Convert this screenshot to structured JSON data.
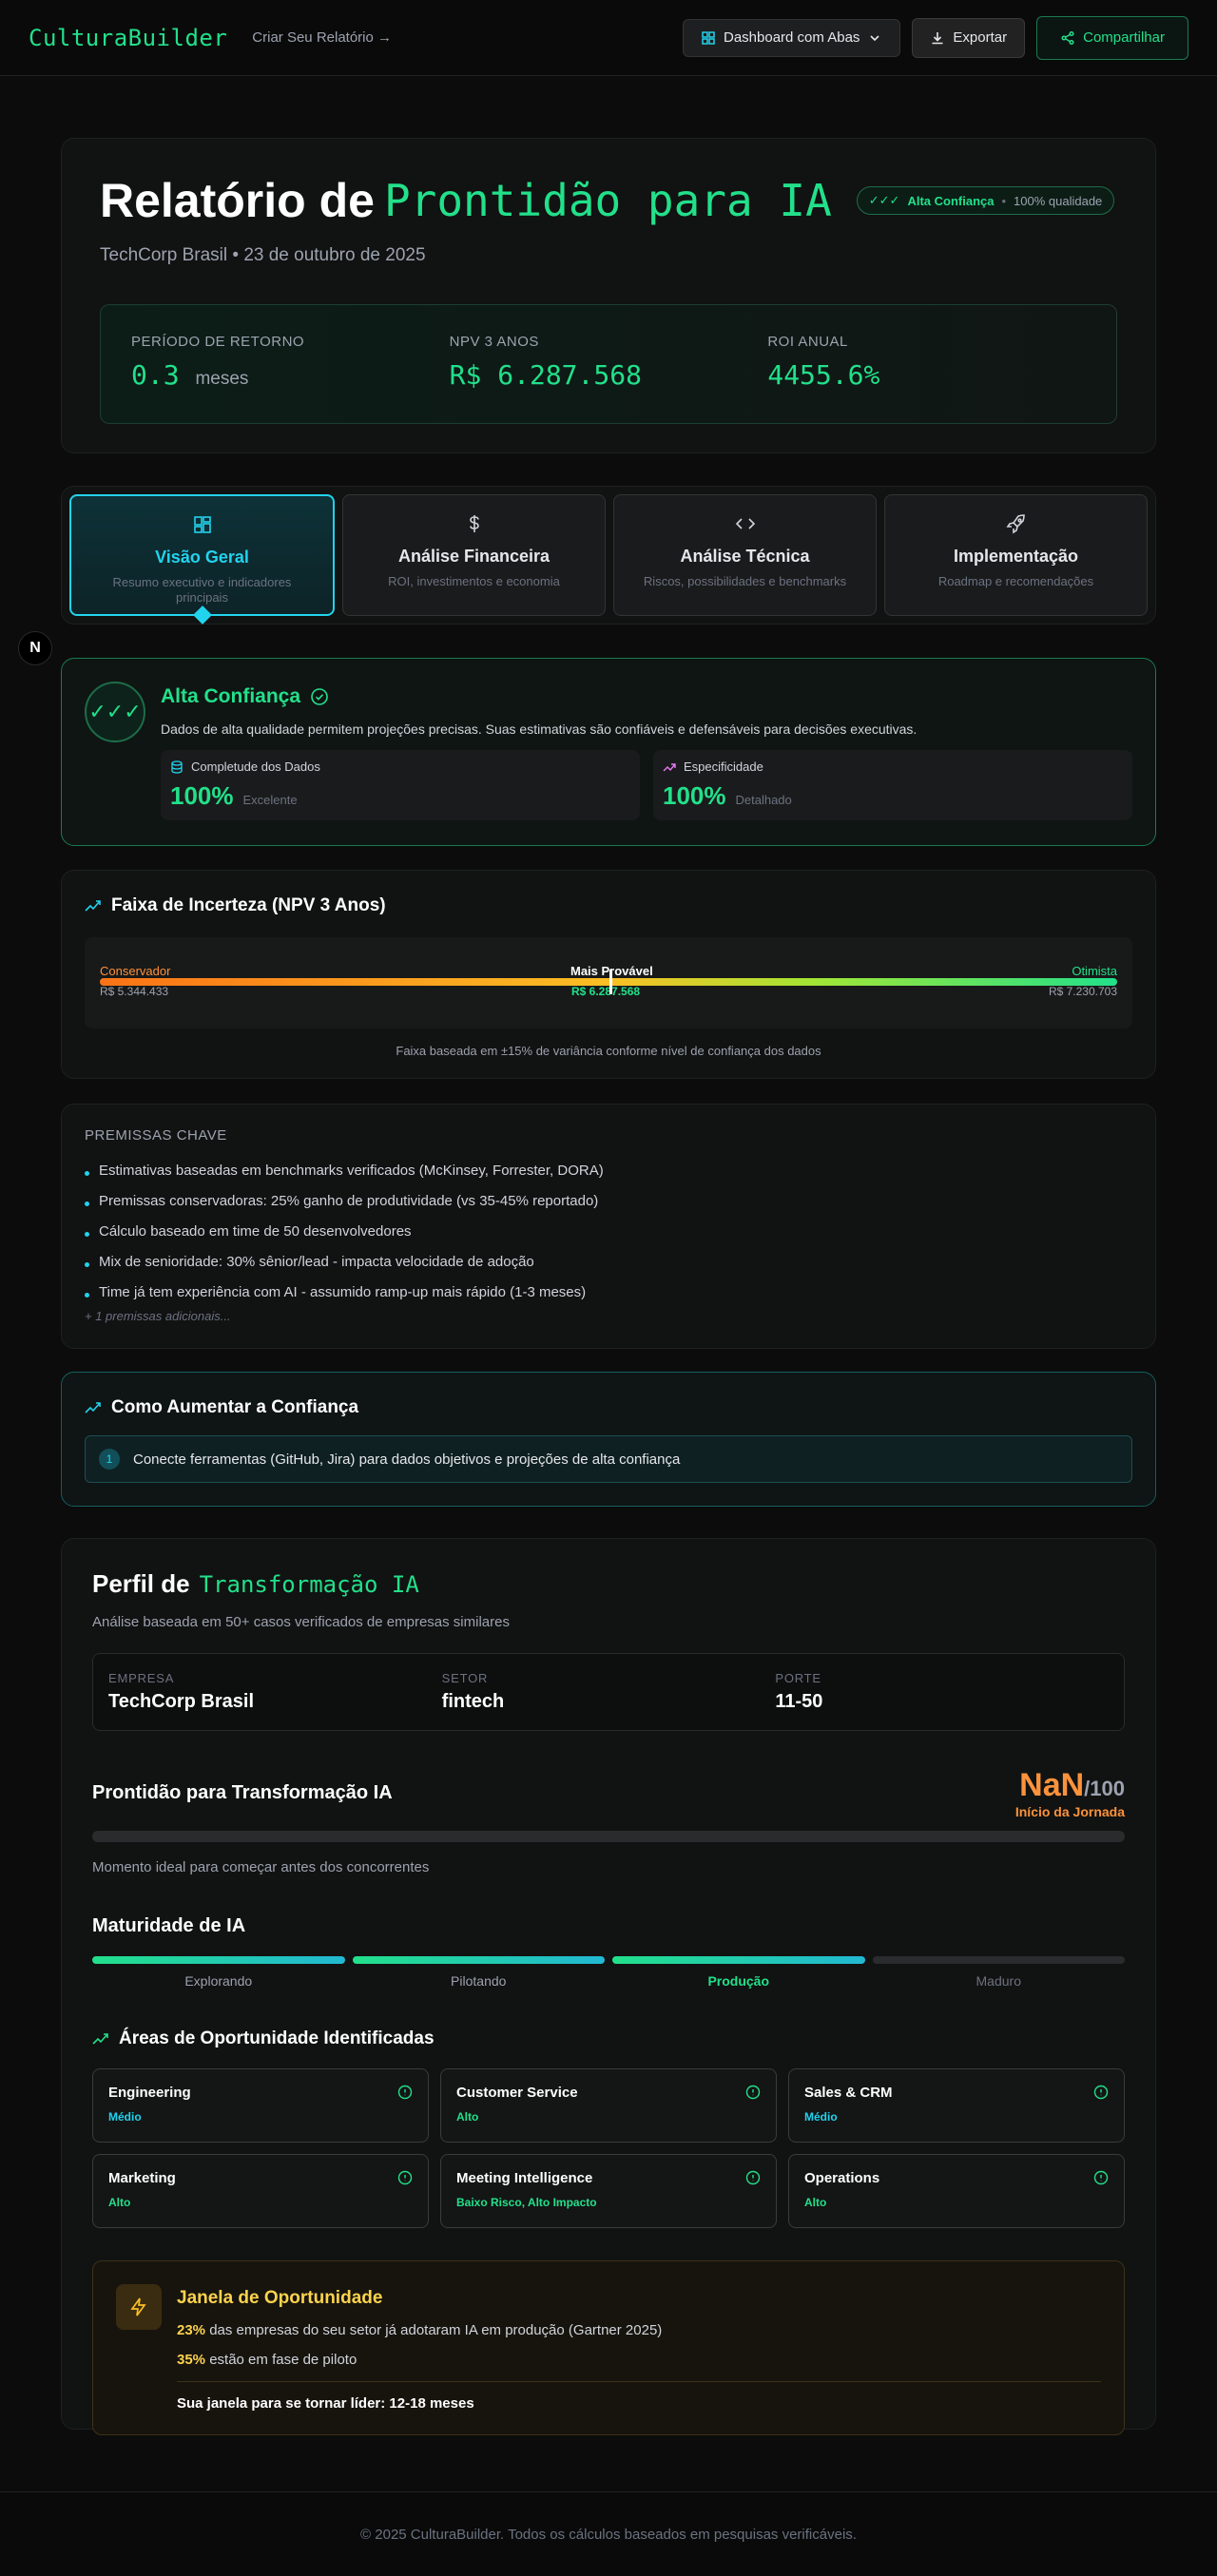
{
  "header": {
    "brand": "CulturaBuilder",
    "create_link": "Criar Seu Relatório →",
    "view_selector": "Dashboard com Abas",
    "export_label": "Exportar",
    "share_label": "Compartilhar"
  },
  "hero": {
    "title_prefix": "Relatório de",
    "title_accent": "Prontidão para IA",
    "badge_checks": "✓✓✓",
    "badge_label": "Alta Confiança",
    "badge_sep": "•",
    "badge_quality": "100% qualidade",
    "subtitle": "TechCorp Brasil • 23 de outubro de 2025",
    "metrics": [
      {
        "label": "PERÍODO DE RETORNO",
        "value": "0.3",
        "unit": "meses"
      },
      {
        "label": "NPV 3 ANOS",
        "value": "R$ 6.287.568",
        "unit": ""
      },
      {
        "label": "ROI ANUAL",
        "value": "4455.6%",
        "unit": ""
      }
    ]
  },
  "tabs": [
    {
      "title": "Visão Geral",
      "desc": "Resumo executivo e indicadores principais",
      "icon": "dashboard-icon",
      "active": true
    },
    {
      "title": "Análise Financeira",
      "desc": "ROI, investimentos e economia",
      "icon": "dollar-icon",
      "active": false
    },
    {
      "title": "Análise Técnica",
      "desc": "Riscos, possibilidades e benchmarks",
      "icon": "code-icon",
      "active": false
    },
    {
      "title": "Implementação",
      "desc": "Roadmap e recomendações",
      "icon": "rocket-icon",
      "active": false
    }
  ],
  "side_button": "N",
  "confidence": {
    "checks": "✓✓✓",
    "title": "Alta Confiança",
    "desc": "Dados de alta qualidade permitem projeções precisas. Suas estimativas são confiáveis e defensáveis para decisões executivas.",
    "stats": [
      {
        "label": "Completude dos Dados",
        "value": "100%",
        "sub": "Excelente"
      },
      {
        "label": "Especificidade",
        "value": "100%",
        "sub": "Detalhado"
      }
    ]
  },
  "range": {
    "title": "Faixa de Incerteza (NPV 3 Anos)",
    "conservative_label": "Conservador",
    "conservative_value": "R$ 5.344.433",
    "likely_label": "Mais Provável",
    "likely_value": "R$ 6.287.568",
    "optimistic_label": "Otimista",
    "optimistic_value": "R$ 7.230.703",
    "footnote": "Faixa baseada em ±15% de variância conforme nível de confiança dos dados"
  },
  "premises": {
    "title": "PREMISSAS CHAVE",
    "items": [
      "Estimativas baseadas em benchmarks verificados (McKinsey, Forrester, DORA)",
      "Premissas conservadoras: 25% ganho de produtividade (vs 35-45% reportado)",
      "Cálculo baseado em time de 50 desenvolvedores",
      "Mix de senioridade: 30% sênior/lead - impacta velocidade de adoção",
      "Time já tem experiência com AI - assumido ramp-up mais rápido (1-3 meses)"
    ],
    "more": "+ 1 premissas adicionais..."
  },
  "improve": {
    "title": "Como Aumentar a Confiança",
    "items": [
      {
        "num": "1",
        "text": "Conecte ferramentas (GitHub, Jira) para dados objetivos e projeções de alta confiança"
      }
    ]
  },
  "profile": {
    "title_prefix": "Perfil de",
    "title_accent": "Transformação IA",
    "subtitle": "Análise baseada em 50+ casos verificados de empresas similares",
    "company": [
      {
        "key": "EMPRESA",
        "value": "TechCorp Brasil"
      },
      {
        "key": "SETOR",
        "value": "fintech"
      },
      {
        "key": "PORTE",
        "value": "11-50"
      }
    ],
    "readiness_title": "Prontidão para Transformação IA",
    "score": "NaN",
    "score_den": "/100",
    "score_label": "Início da Jornada",
    "readiness_note": "Momento ideal para começar antes dos concorrentes",
    "maturity_title": "Maturidade de IA",
    "maturity": [
      {
        "label": "Explorando",
        "state": "done"
      },
      {
        "label": "Pilotando",
        "state": "done"
      },
      {
        "label": "Produção",
        "state": "current"
      },
      {
        "label": "Maduro",
        "state": "off"
      }
    ],
    "areas_title": "Áreas de Oportunidade Identificadas",
    "areas": [
      {
        "name": "Engineering",
        "level": "Médio",
        "color": "#22d3ee"
      },
      {
        "name": "Customer Service",
        "level": "Alto",
        "color": "#22e08a"
      },
      {
        "name": "Sales & CRM",
        "level": "Médio",
        "color": "#22d3ee"
      },
      {
        "name": "Marketing",
        "level": "Alto",
        "color": "#22e08a"
      },
      {
        "name": "Meeting Intelligence",
        "level": "Baixo Risco, Alto Impacto",
        "color": "#22e08a"
      },
      {
        "name": "Operations",
        "level": "Alto",
        "color": "#22e08a"
      }
    ],
    "window": {
      "title": "Janela de Oportunidade",
      "line1_strong": "23%",
      "line1_rest": " das empresas do seu setor já adotaram IA em produção (Gartner 2025)",
      "line2_strong": "35%",
      "line2_rest": " estão em fase de piloto",
      "final": "Sua janela para se tornar líder: 12-18 meses"
    }
  },
  "footer": "© 2025 CulturaBuilder. Todos os cálculos baseados em pesquisas verificáveis."
}
